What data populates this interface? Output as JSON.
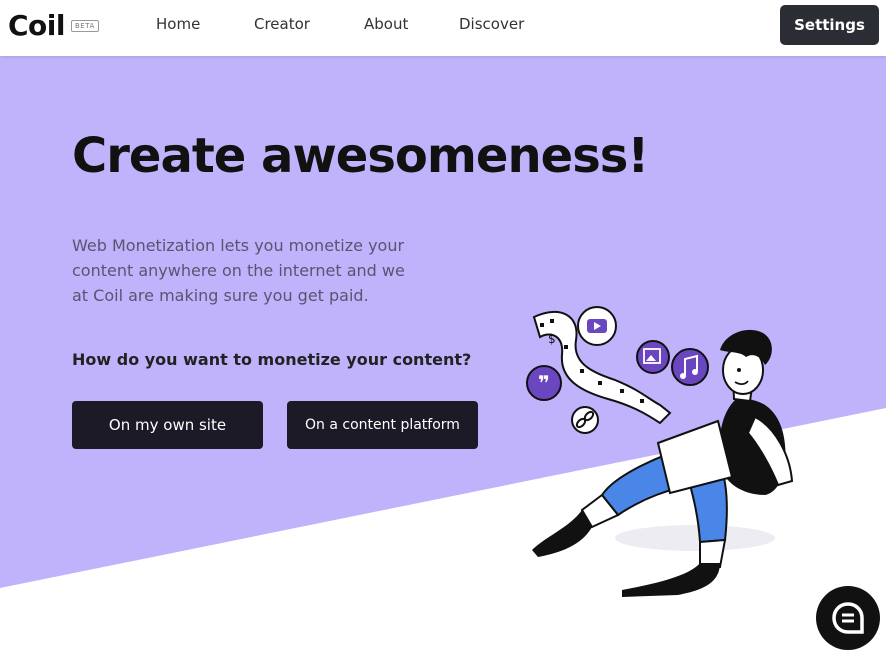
{
  "header": {
    "logo_text": "Coil",
    "beta_label": "BETA",
    "nav": [
      "Home",
      "Creator",
      "About",
      "Discover"
    ],
    "settings_label": "Settings"
  },
  "hero": {
    "title": "Create awesomeness!",
    "description": "Web Monetization lets you monetize your content anywhere on the internet and we at Coil are making sure you get paid.",
    "question": "How do you want to monetize your content?",
    "cta_own_site": "On my own site",
    "cta_platform": "On a content platform"
  },
  "colors": {
    "hero_background": "#c0b3fc",
    "button_dark": "#1c1a26",
    "settings_button": "#2a2d33",
    "accent_purple": "#6b46c1",
    "jeans_blue": "#4a86e8"
  },
  "icons": [
    "youtube-icon",
    "image-icon",
    "music-icon",
    "quote-icon",
    "link-icon",
    "chat-icon"
  ]
}
